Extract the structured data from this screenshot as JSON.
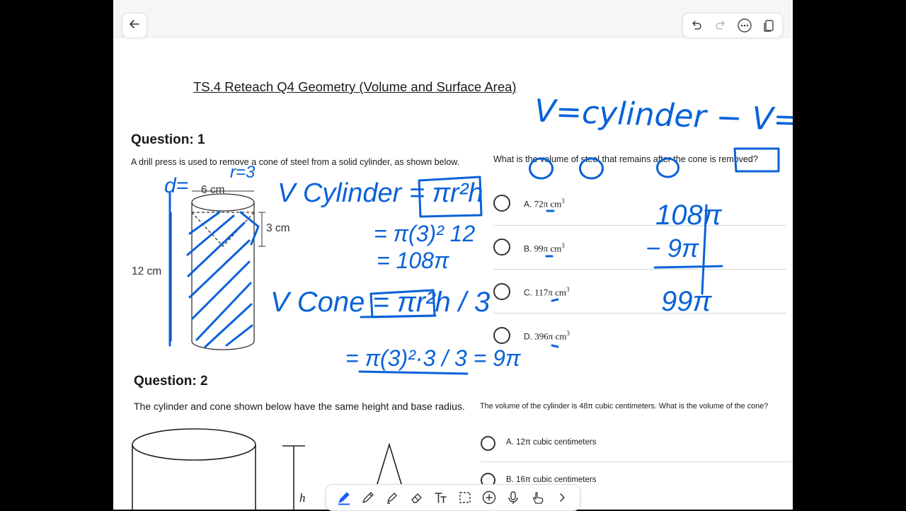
{
  "app": {
    "accent_color": "#1a5cff",
    "ink_color": "#0a62d8",
    "toolbar_icons": [
      "back-arrow-icon",
      "undo-icon",
      "redo-icon",
      "more-icon",
      "copy-icon"
    ]
  },
  "document": {
    "title": "TS.4 Reteach Q4 Geometry (Volume and Surface Area)"
  },
  "question1": {
    "heading": "Question: 1",
    "prompt": "A drill press is used to remove a cone of steel from a solid cylinder, as shown below.",
    "question": "What is the volume of steel that remains after the cone is removed?",
    "figure": {
      "diameter_label": "6 cm",
      "cone_height_label": "3 cm",
      "height_label": "12 cm"
    },
    "options": [
      {
        "letter": "A.",
        "value": "72π cm",
        "exp": "3"
      },
      {
        "letter": "B.",
        "value": "99π cm",
        "exp": "3"
      },
      {
        "letter": "C.",
        "value": "117π cm",
        "exp": "3"
      },
      {
        "letter": "D.",
        "value": "396π cm",
        "exp": "3"
      }
    ]
  },
  "question2": {
    "heading": "Question: 2",
    "prompt": "The cylinder and cone shown below have the same height and base radius.",
    "question": "The volume of the cylinder is 48π cubic centimeters. What is the volume of the cone?",
    "figure": {
      "height_label": "h"
    },
    "options": [
      {
        "letter": "A.",
        "value": "12π cubic centimeters"
      },
      {
        "letter": "B.",
        "value": "16π cubic centimeters"
      }
    ]
  },
  "handwriting": {
    "eq_top": "V=cylinder − V= cone",
    "r_note": "r=3",
    "d_note": "d=",
    "cyl_formula": "V Cylinder = πr²h",
    "cyl_step1": "= π(3)² 12",
    "cyl_step2": "= 108π",
    "cone_formula": "V Cone = πr²h / 3",
    "cone_step": "= π(3)²·3 / 3 = 9π",
    "calc_top": "108π",
    "calc_sub": "− 9π",
    "calc_result": "99π"
  },
  "bottom_toolbar": {
    "tools": [
      "pen-icon",
      "pencil-icon",
      "highlighter-icon",
      "eraser-icon",
      "text-tool-icon",
      "lasso-select-icon",
      "add-icon",
      "microphone-icon",
      "touch-draw-icon",
      "chevron-right-icon"
    ]
  }
}
